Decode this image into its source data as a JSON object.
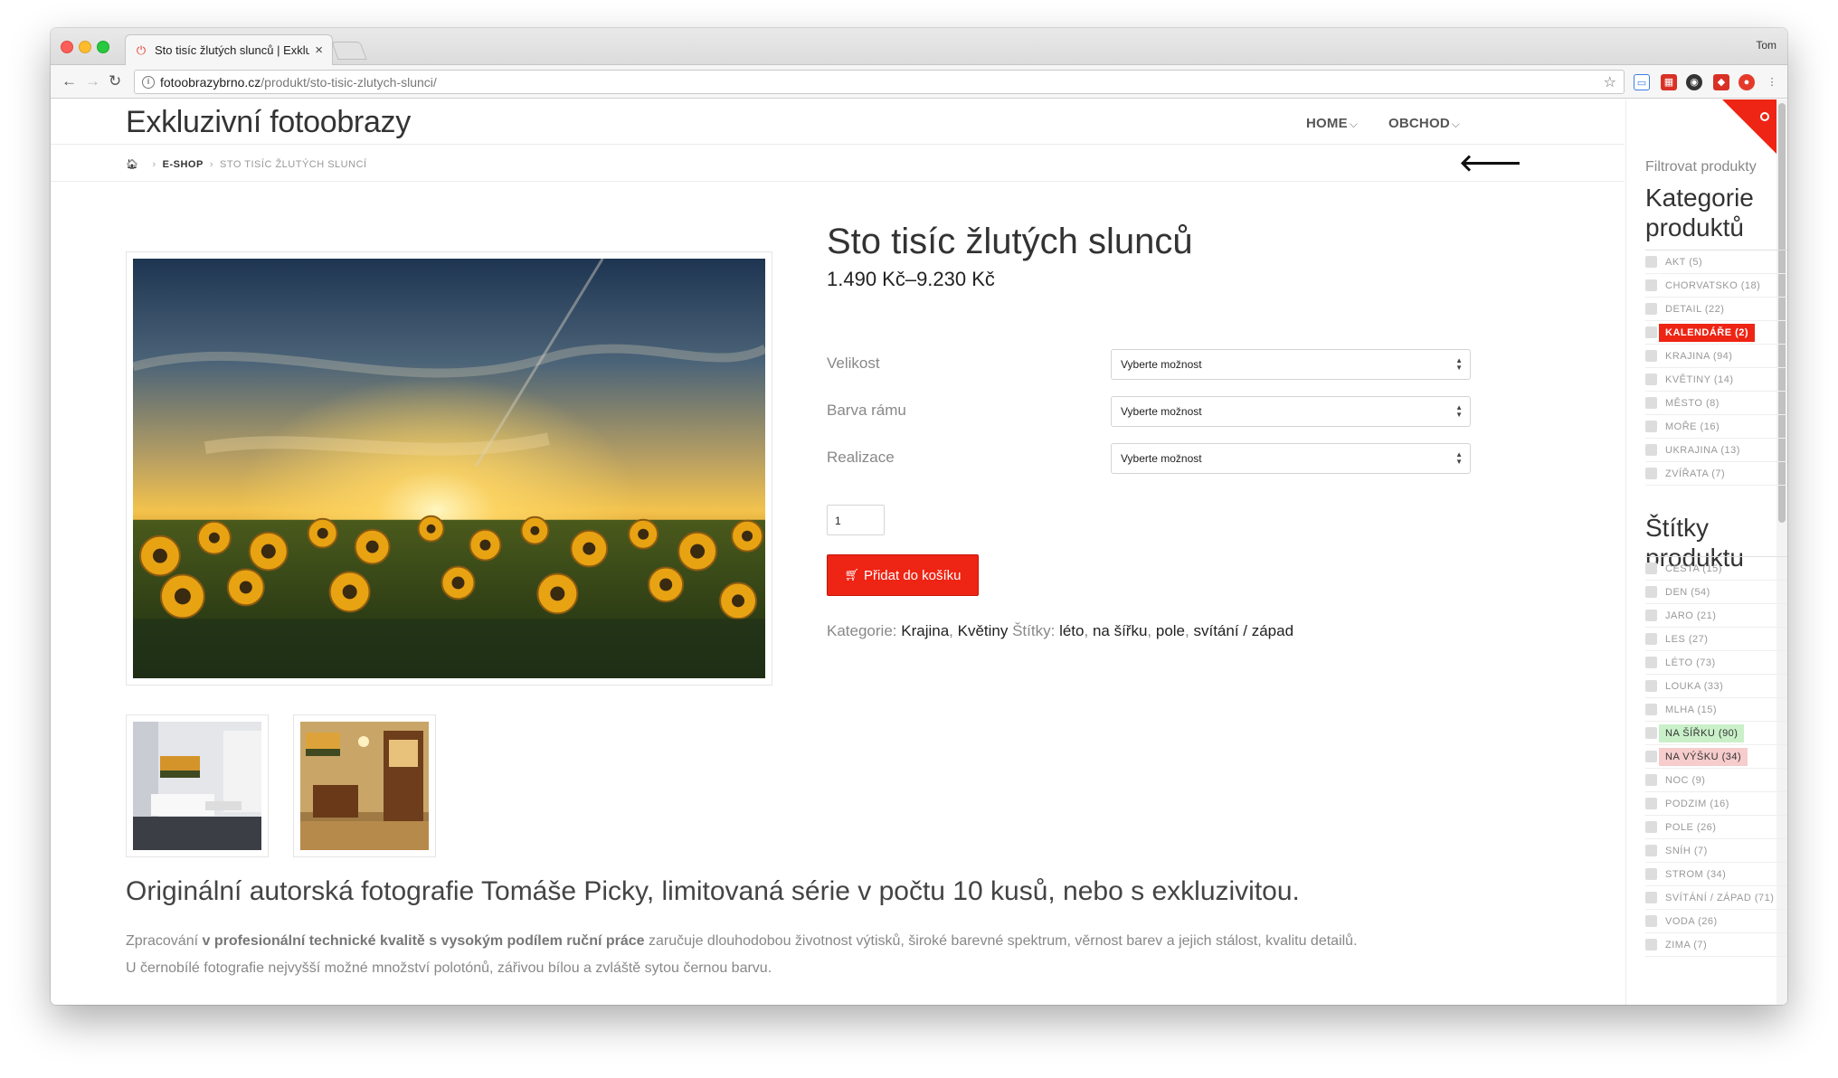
{
  "browser": {
    "tab_title": "Sto tisíc žlutých slunců | Exkluz",
    "profile": "Tom",
    "url_host": "fotoobrazybrno.cz",
    "url_path": "/produkt/sto-tisic-zlutych-slunci/"
  },
  "header": {
    "site_title": "Exkluzivní fotoobrazy",
    "nav": [
      "HOME",
      "OBCHOD"
    ]
  },
  "breadcrumb": {
    "eshop": "E-SHOP",
    "current": "STO TISÍC ŽLUTÝCH SLUNCÍ"
  },
  "product": {
    "title": "Sto tisíc žlutých slunců",
    "price": "1.490 Kč–9.230 Kč",
    "options": [
      {
        "label": "Velikost",
        "value": "Vyberte možnost"
      },
      {
        "label": "Barva rámu",
        "value": "Vyberte možnost"
      },
      {
        "label": "Realizace",
        "value": "Vyberte možnost"
      }
    ],
    "quantity": "1",
    "add_to_cart": "Přidat do košíku",
    "categories_label": "Kategorie:",
    "categories": [
      "Krajina",
      "Květiny"
    ],
    "tags_label": "Štítky:",
    "tags": [
      "léto",
      "na šířku",
      "pole",
      "svítání / západ"
    ]
  },
  "description": {
    "headline": "Originální autorská fotografie Tomáše Picky, limitovaná série v počtu 10 kusů, nebo s exkluzivitou.",
    "line1_prefix": "Zpracování ",
    "line1_bold": "v profesionální technické kvalitě s vysokým podílem ruční práce",
    "line1_suffix": " zaručuje dlouhodobou životnost výtisků, široké barevné spektrum, věrnost barev a jejich stálost, kvalitu detailů.",
    "line2": "U černobílé fotografie nejvyšší možné množství polotónů, zářivou bílou a zvláště sytou černou barvu."
  },
  "sidebar": {
    "kicker": "Filtrovat produkty",
    "categories_heading_1": "Kategorie",
    "categories_heading_2": "produktů",
    "categories": [
      {
        "label": "AKT (5)"
      },
      {
        "label": "CHORVATSKO (18)"
      },
      {
        "label": "DETAIL (22)"
      },
      {
        "label": "KALENDÁŘE (2)"
      },
      {
        "label": "KRAJINA (94)"
      },
      {
        "label": "KVĚTINY (14)"
      },
      {
        "label": "MĚSTO (8)"
      },
      {
        "label": "MOŘE (16)"
      },
      {
        "label": "UKRAJINA (13)"
      },
      {
        "label": "ZVÍŘATA (7)"
      }
    ],
    "tags_heading": "Štítky produktu",
    "tags": [
      {
        "label": "CESTA (15)"
      },
      {
        "label": "DEN (54)"
      },
      {
        "label": "JARO (21)"
      },
      {
        "label": "LES (27)"
      },
      {
        "label": "LÉTO (73)"
      },
      {
        "label": "LOUKA (33)"
      },
      {
        "label": "MLHA (15)"
      },
      {
        "label": "NA ŠÍŘKU (90)"
      },
      {
        "label": "NA VÝŠKU (34)"
      },
      {
        "label": "NOC (9)"
      },
      {
        "label": "PODZIM (16)"
      },
      {
        "label": "POLE (26)"
      },
      {
        "label": "SNÍH (7)"
      },
      {
        "label": "STROM (34)"
      },
      {
        "label": "SVÍTÁNÍ / ZÁPAD (71)"
      },
      {
        "label": "VODA (26)"
      },
      {
        "label": "ZIMA (7)"
      }
    ]
  },
  "colors": {
    "accent": "#ee2414",
    "tag_green": "#c9f0c9",
    "tag_pink": "#f6cccc"
  },
  "icons": [
    "power-icon",
    "close-icon",
    "back-icon",
    "forward-icon",
    "reload-icon",
    "info-icon",
    "star-icon",
    "home-icon",
    "arrow-left-icon",
    "cart-icon"
  ]
}
